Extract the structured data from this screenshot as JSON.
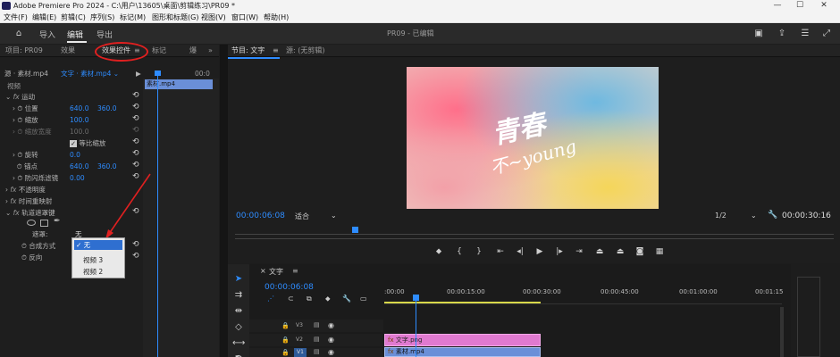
{
  "window": {
    "title": "Adobe Premiere Pro 2024 - C:\\用户\\13605\\桌面\\剪辑练习\\PR09 *"
  },
  "menu": [
    "文件(F)",
    "编辑(E)",
    "剪辑(C)",
    "序列(S)",
    "标记(M)",
    "图形和标题(G)",
    "视图(V)",
    "窗口(W)",
    "帮助(H)"
  ],
  "workspace": {
    "tabs": [
      "导入",
      "编辑",
      "导出"
    ],
    "active": "编辑",
    "project_title": "PR09 - 已编辑"
  },
  "left_panel": {
    "tabs": [
      "项目: PR09",
      "效果",
      "效果控件",
      "标记",
      "爆"
    ],
    "active_tab": "效果控件",
    "source_label": "源 · 素材.mp4",
    "clip_label": "文字 · 素材.mp4",
    "mini_timecode": "00:0",
    "mini_clip": "素材.mp4",
    "section_video": "视频",
    "motion": "运动",
    "position": {
      "label": "位置",
      "x": "640.0",
      "y": "360.0"
    },
    "scale": {
      "label": "缩放",
      "value": "100.0"
    },
    "scale_width": {
      "label": "缩放宽度",
      "value": "100.0"
    },
    "uniform_scale": "等比缩放",
    "rotation": {
      "label": "旋转",
      "value": "0.0"
    },
    "anchor": {
      "label": "锚点",
      "x": "640.0",
      "y": "360.0"
    },
    "antiflicker": {
      "label": "防闪烁滤镜",
      "value": "0.00"
    },
    "opacity": "不透明度",
    "time_remap": "时间重映射",
    "track_matte": "轨道遮罩键",
    "matte_label": "遮罩:",
    "matte_value": "无",
    "composite": "合成方式",
    "reverse": "反向",
    "dropdown_options": [
      "无",
      "视频 3",
      "视频 2"
    ]
  },
  "program": {
    "tabs": [
      "节目: 文字",
      "源: (无剪辑)"
    ],
    "active_tab": "节目: 文字",
    "timecode": "00:00:06:08",
    "fit": "适合",
    "quality": "1/2",
    "duration": "00:00:30:16",
    "calligraphy_line1": "青春",
    "calligraphy_line2": "不~young"
  },
  "timeline": {
    "tab": "文字",
    "timecode": "00:00:06:08",
    "ruler": [
      ":00:00",
      "00:00:15:00",
      "00:00:30:00",
      "00:00:45:00",
      "00:01:00:00",
      "00:01:15"
    ],
    "tracks": [
      "V3",
      "V2",
      "V1"
    ],
    "clip_v2": "文字.png",
    "clip_v1": "素材.mp4"
  },
  "colors": {
    "accent": "#2e8cff",
    "clip_pink": "#e07ad0",
    "clip_blue": "#6a8fd8",
    "annotation_red": "#e02020"
  }
}
